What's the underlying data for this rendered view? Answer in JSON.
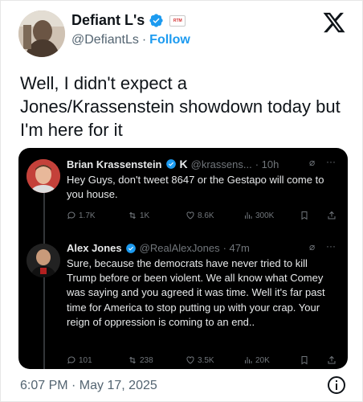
{
  "author": {
    "name": "Defiant L's",
    "badge": "RTM",
    "handle": "@DefiantLs",
    "separator": "·",
    "follow_label": "Follow"
  },
  "tweet": {
    "text": "Well, I didn't expect a Jones/Krassenstein showdown today but I'm here for it",
    "timestamp": "6:07 PM · May 17, 2025"
  },
  "embedded": {
    "tweet1": {
      "name": "Brian Krassenstein",
      "handle": "@krassens...",
      "time": "· 10h",
      "text": "Hey Guys, don't tweet 8647 or the Gestapo will come to you house.",
      "replies": "1.7K",
      "reposts": "1K",
      "likes": "8.6K",
      "views": "300K"
    },
    "tweet2": {
      "name": "Alex Jones",
      "handle": "@RealAlexJones",
      "time": "· 47m",
      "text": "Sure, because the democrats have never tried to kill Trump before or been violent. We all know what Comey was saying and you agreed it was time. Well it's far past time for America to stop putting up with your crap. Your reign of oppression is coming to an end..",
      "replies": "101",
      "reposts": "238",
      "likes": "3.5K",
      "views": "20K"
    }
  },
  "colors": {
    "accent": "#1d9bf0",
    "text": "#0f1419",
    "muted": "#536471",
    "dark_bg": "#000000"
  }
}
